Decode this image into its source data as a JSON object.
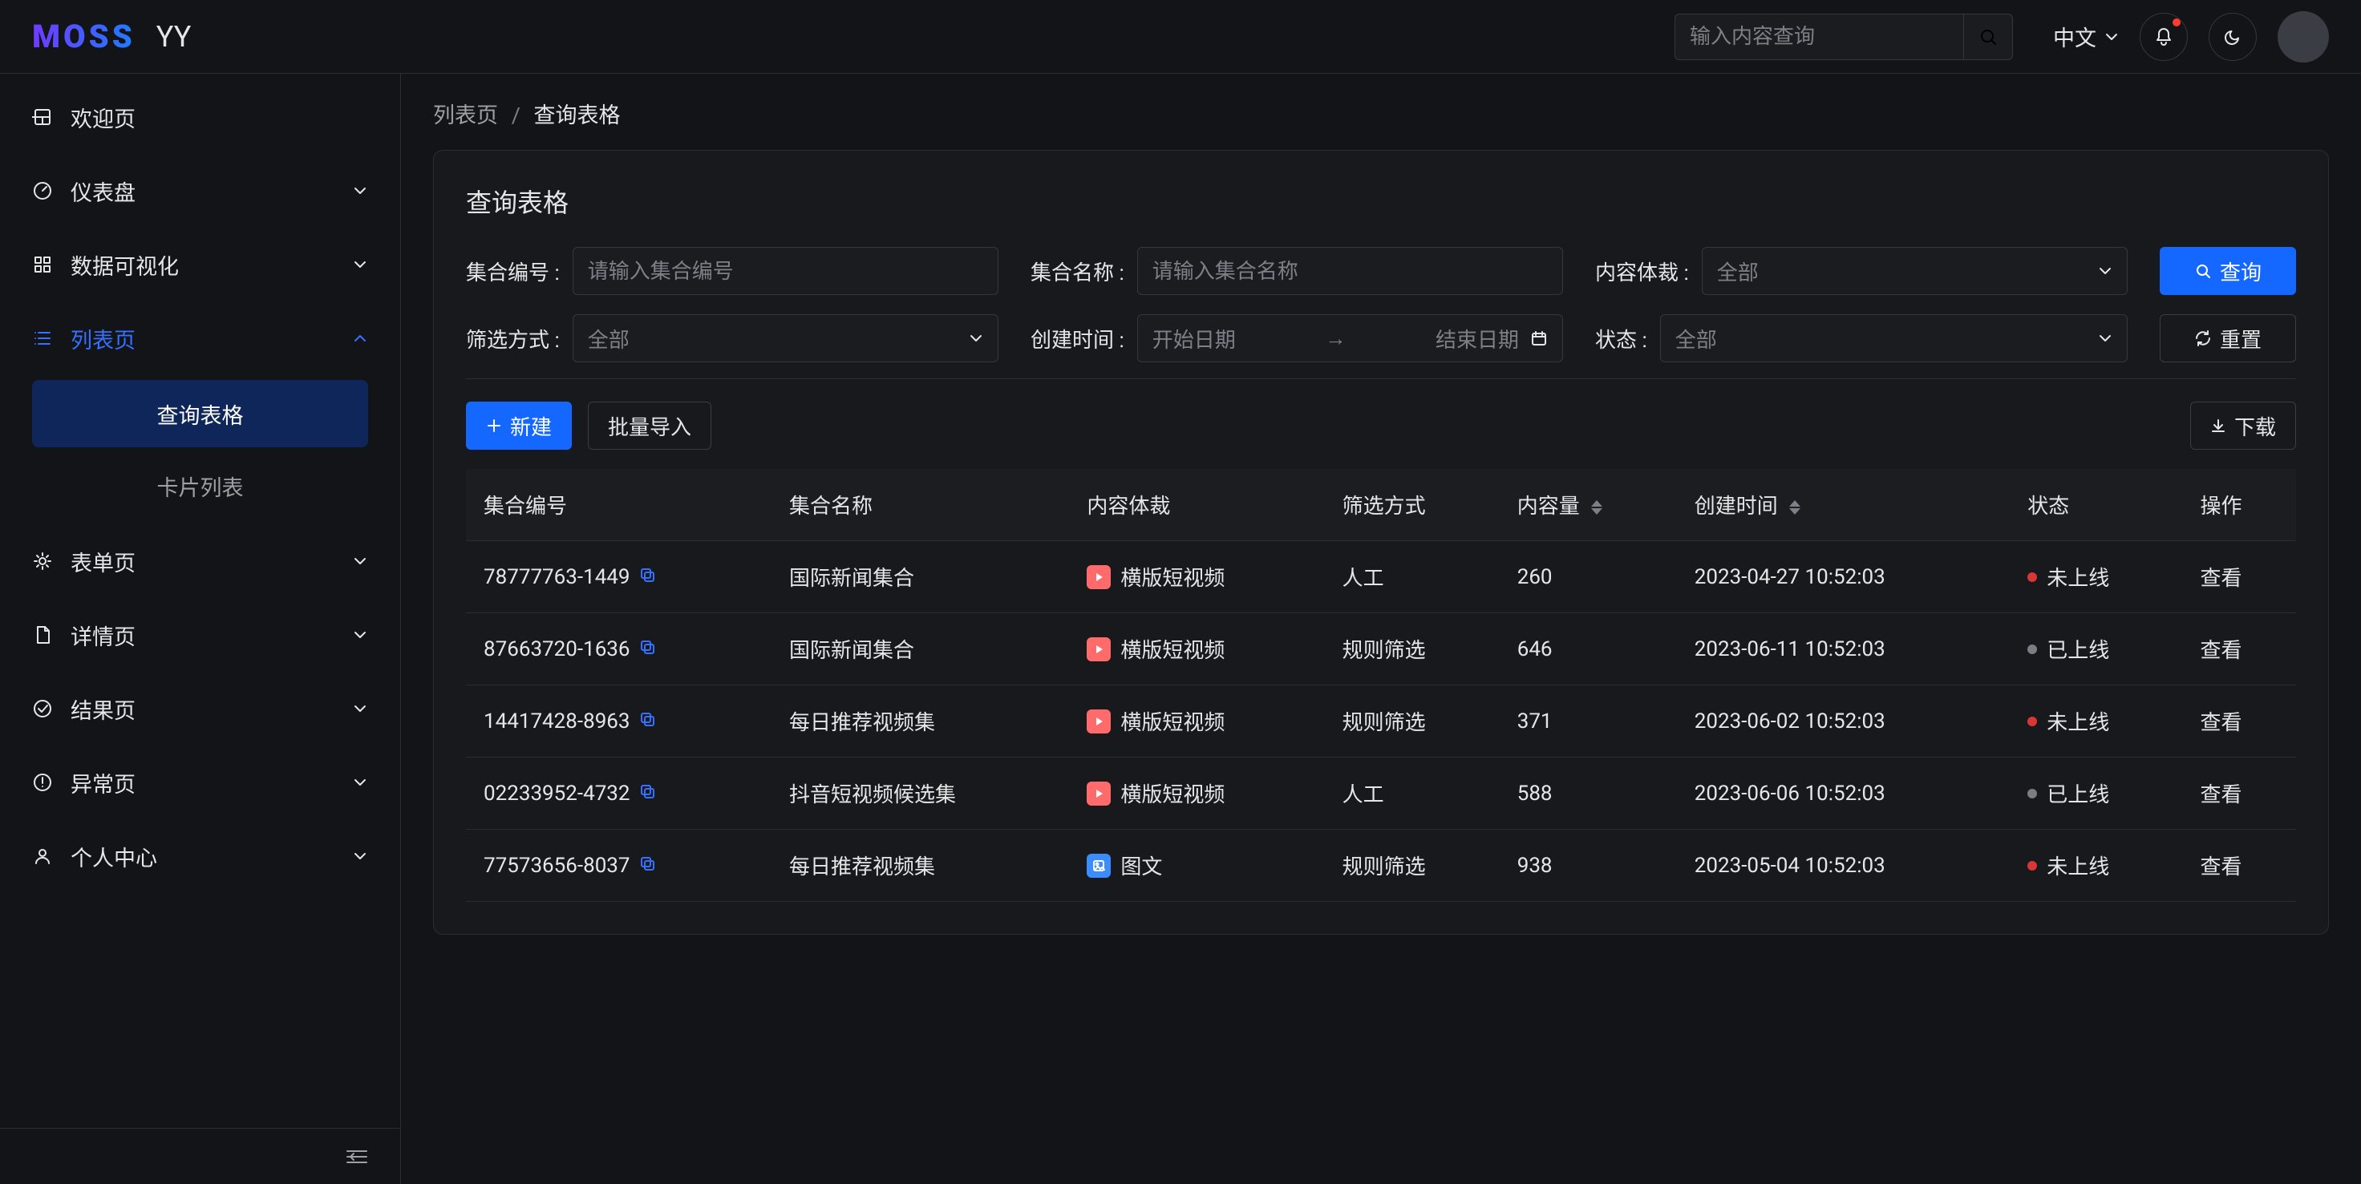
{
  "app": {
    "logo": "MOSS",
    "sub": "YY"
  },
  "header": {
    "search_placeholder": "输入内容查询",
    "lang": "中文"
  },
  "sidebar": {
    "items": [
      {
        "icon": "home",
        "label": "欢迎页",
        "expandable": false
      },
      {
        "icon": "gauge",
        "label": "仪表盘",
        "expandable": true
      },
      {
        "icon": "grid",
        "label": "数据可视化",
        "expandable": true
      },
      {
        "icon": "list",
        "label": "列表页",
        "expandable": true,
        "active": true,
        "open": true,
        "children": [
          {
            "label": "查询表格",
            "selected": true
          },
          {
            "label": "卡片列表",
            "selected": false
          }
        ]
      },
      {
        "icon": "gear",
        "label": "表单页",
        "expandable": true
      },
      {
        "icon": "doc",
        "label": "详情页",
        "expandable": true
      },
      {
        "icon": "check",
        "label": "结果页",
        "expandable": true
      },
      {
        "icon": "alert",
        "label": "异常页",
        "expandable": true
      },
      {
        "icon": "user",
        "label": "个人中心",
        "expandable": true
      }
    ]
  },
  "breadcrumb": {
    "root": "列表页",
    "current": "查询表格"
  },
  "page": {
    "title": "查询表格",
    "filters": {
      "set_id": {
        "label": "集合编号 :",
        "placeholder": "请输入集合编号"
      },
      "set_name": {
        "label": "集合名称 :",
        "placeholder": "请输入集合名称"
      },
      "content_type": {
        "label": "内容体裁 :",
        "value": "全部"
      },
      "filter_mode": {
        "label": "筛选方式 :",
        "value": "全部"
      },
      "created": {
        "label": "创建时间 :",
        "start": "开始日期",
        "end": "结束日期"
      },
      "status": {
        "label": "状态 :",
        "value": "全部"
      }
    },
    "actions": {
      "query": "查询",
      "reset": "重置",
      "new": "新建",
      "import": "批量导入",
      "download": "下载"
    },
    "table": {
      "columns": [
        "集合编号",
        "集合名称",
        "内容体裁",
        "筛选方式",
        "内容量",
        "创建时间",
        "状态",
        "操作"
      ],
      "rows": [
        {
          "id": "78777763-1449",
          "name": "国际新闻集合",
          "type": "横版短视频",
          "type_kind": "video",
          "filter": "人工",
          "count": "260",
          "created": "2023-04-27 10:52:03",
          "status": "未上线",
          "status_kind": "off",
          "action": "查看"
        },
        {
          "id": "87663720-1636",
          "name": "国际新闻集合",
          "type": "横版短视频",
          "type_kind": "video",
          "filter": "规则筛选",
          "count": "646",
          "created": "2023-06-11 10:52:03",
          "status": "已上线",
          "status_kind": "on",
          "action": "查看"
        },
        {
          "id": "14417428-8963",
          "name": "每日推荐视频集",
          "type": "横版短视频",
          "type_kind": "video",
          "filter": "规则筛选",
          "count": "371",
          "created": "2023-06-02 10:52:03",
          "status": "未上线",
          "status_kind": "off",
          "action": "查看"
        },
        {
          "id": "02233952-4732",
          "name": "抖音短视频候选集",
          "type": "横版短视频",
          "type_kind": "video",
          "filter": "人工",
          "count": "588",
          "created": "2023-06-06 10:52:03",
          "status": "已上线",
          "status_kind": "on",
          "action": "查看"
        },
        {
          "id": "77573656-8037",
          "name": "每日推荐视频集",
          "type": "图文",
          "type_kind": "image",
          "filter": "规则筛选",
          "count": "938",
          "created": "2023-05-04 10:52:03",
          "status": "未上线",
          "status_kind": "off",
          "action": "查看"
        }
      ]
    }
  }
}
